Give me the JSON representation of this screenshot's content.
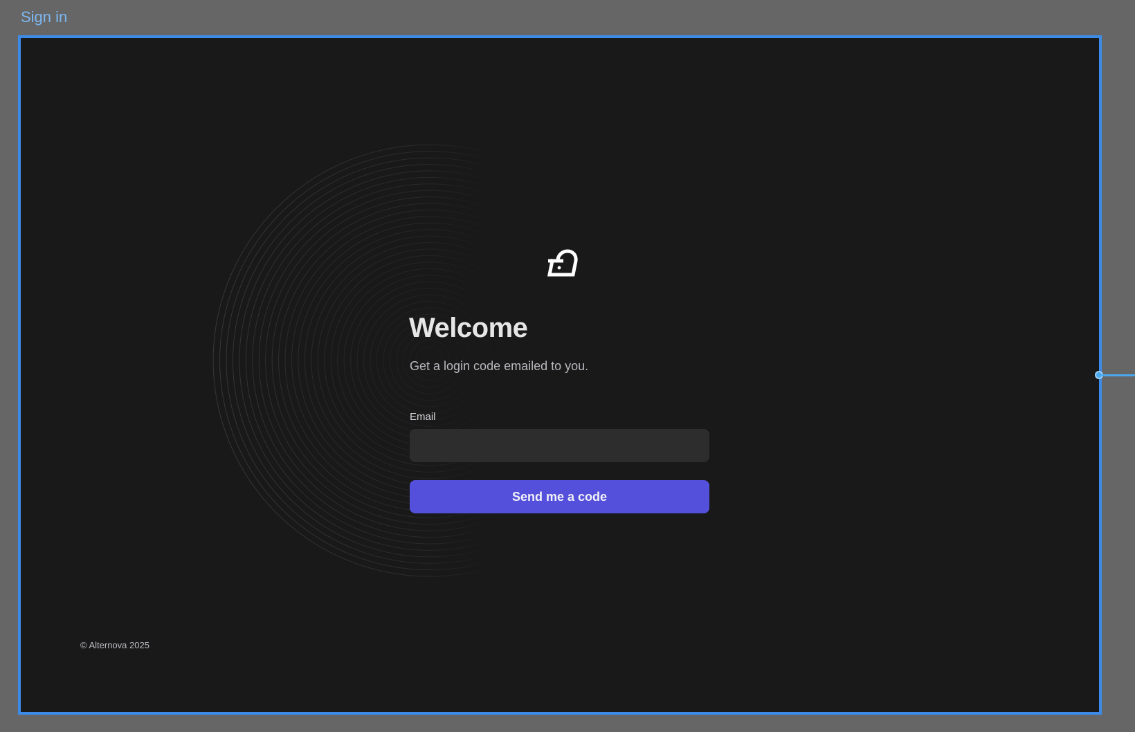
{
  "frame": {
    "label": "Sign in"
  },
  "login": {
    "title": "Welcome",
    "subtitle": "Get a login code emailed to you.",
    "email_label": "Email",
    "email_value": "",
    "send_button_label": "Send me a code"
  },
  "footer": {
    "copyright": "© Alternova 2025"
  },
  "icons": {
    "logo": "alternova-logo-icon",
    "resize": "resize-handle-icon"
  },
  "colors": {
    "background": "#19191a",
    "frame_border": "#3d8be8",
    "accent_button": "#5450dc",
    "input_bg": "#2d2d2e"
  }
}
